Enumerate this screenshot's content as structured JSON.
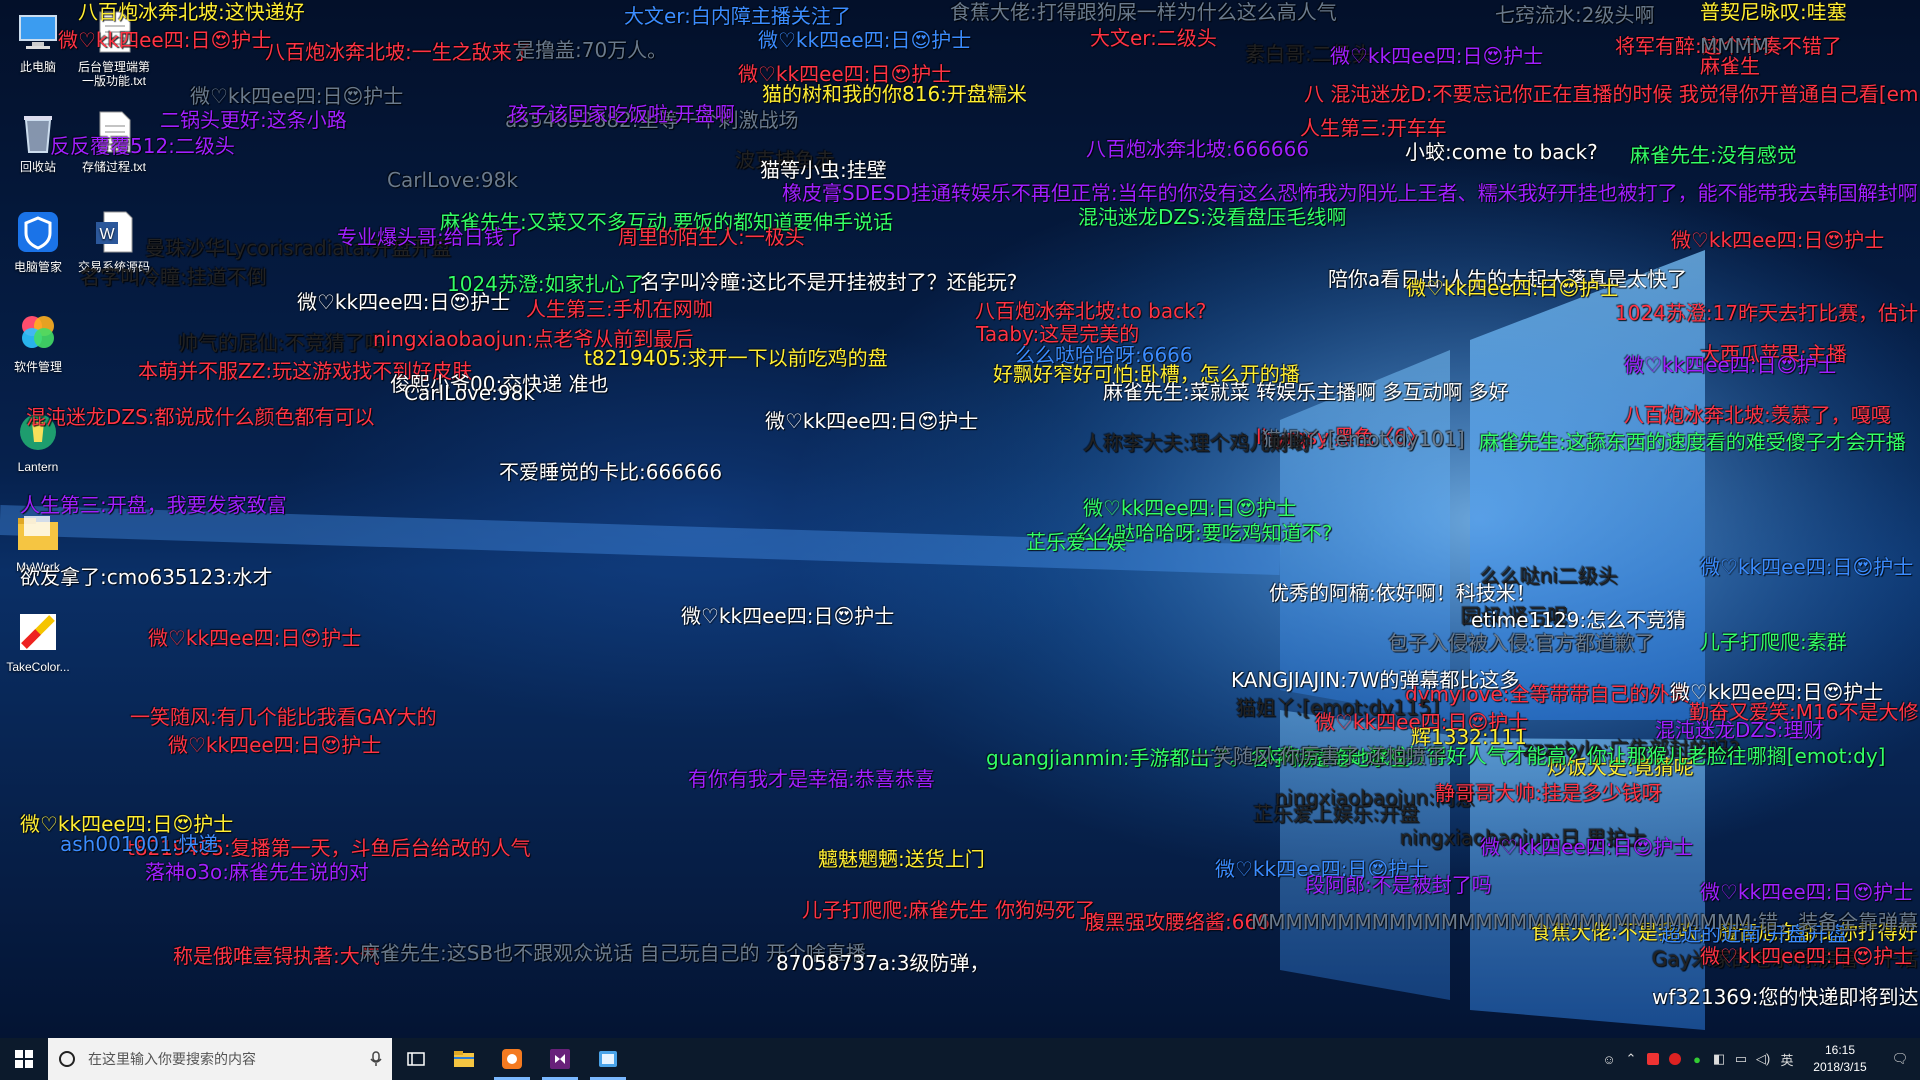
{
  "desktop_icons": [
    {
      "label": "此电脑",
      "icon": "computer-icon"
    },
    {
      "label": "后台管理端第一版功能.txt",
      "icon": "text-file-icon"
    },
    {
      "label": "回收站",
      "icon": "recycle-bin-icon"
    },
    {
      "label": "存储过程.txt",
      "icon": "text-file-icon"
    },
    {
      "label": "电脑管家",
      "icon": "shield-icon"
    },
    {
      "label": "交易系统源码",
      "icon": "word-doc-icon"
    },
    {
      "label": "软件管理",
      "icon": "software-manager-icon"
    },
    {
      "label": "Lantern",
      "icon": "lantern-icon"
    },
    {
      "label": "MyWork",
      "icon": "folder-icon"
    },
    {
      "label": "TakeColor...",
      "icon": "takecolor-icon"
    }
  ],
  "danmaku": [
    {
      "text": "八百炮冰奔北坡:这快递好",
      "color": "#ffee33"
    },
    {
      "text": "大文er:白内障主播关注了",
      "color": "#3b8cff"
    },
    {
      "text": "食蕉大佬:打得跟狗屎一样为什么这么高人气",
      "color": "#6a7a8c"
    },
    {
      "text": "七窍流水:2级头啊",
      "color": "#6a7a8c"
    },
    {
      "text": "普契尼咏叹:哇塞",
      "color": "#ffee33"
    },
    {
      "text": "微♡kk四ee四:日😍护士",
      "color": "#ff3344"
    },
    {
      "text": "微♡kk四ee四:日😍护士",
      "color": "#3b8cff"
    },
    {
      "text": "大文er:二级头",
      "color": "#ff3344"
    },
    {
      "text": "八百炮冰奔北坡:一生之敌来了",
      "color": "#ff3344"
    },
    {
      "text": "是撸盖:70万人。",
      "color": "#6a7a8c"
    },
    {
      "text": "素白哥:二级头",
      "color": "#222222"
    },
    {
      "text": "微♡kk四ee四:日😍护士",
      "color": "#a020ff"
    },
    {
      "text": "将军有醉:这个节奏不错了",
      "color": "#ff3344"
    },
    {
      "text": "MMMM",
      "color": "#6a7a8c"
    },
    {
      "text": "麻雀生",
      "color": "#ff3344"
    },
    {
      "text": "微♡kk四ee四:日😍护士",
      "color": "#ff3344"
    },
    {
      "text": "猫的树和我的你816:开盘糯米",
      "color": "#ffee33"
    },
    {
      "text": "八 混沌迷龙D:不要忘记你正在直播的时候 我觉得你开普通自己看[em",
      "color": "#ff3344"
    },
    {
      "text": "微♡kk四ee四:日😍护士",
      "color": "#6a7a8c"
    },
    {
      "text": "二锅头更好:这条小路",
      "color": "#a020ff"
    },
    {
      "text": "a554032882:坐等一个刺激战场",
      "color": "#6a7a8c"
    },
    {
      "text": "孩子该回家吃饭啦:开盘啊",
      "color": "#a020ff"
    },
    {
      "text": "人生第三:开车车",
      "color": "#ff3344"
    },
    {
      "text": "反反覆覆512:二级头",
      "color": "#a020ff"
    },
    {
      "text": "八百炮冰奔北坡:666666",
      "color": "#a020ff"
    },
    {
      "text": "小蛟:come to back?",
      "color": "#ffffff"
    },
    {
      "text": "麻雀先生:没有感觉",
      "color": "#33ff66"
    },
    {
      "text": "波克捕鱼赤",
      "color": "#222222"
    },
    {
      "text": "猫等小虫:挂壁",
      "color": "#ffffff"
    },
    {
      "text": "CarlLove:98k",
      "color": "#6a7a8c"
    },
    {
      "text": "橡皮膏SDESD挂通转娱乐不再但正常:当年的你没有这么恐怖我为阳光上王者、糯米我好开挂也被打了，能不能带我去韩国解封啊",
      "color": "#a020ff"
    },
    {
      "text": "麻雀先生:又菜又不多互动 要饭的都知道要伸手说话",
      "color": "#33ff66"
    },
    {
      "text": "混沌迷龙DZS:没看盘压毛线啊",
      "color": "#33ff66"
    },
    {
      "text": "曼珠沙华Lycorisradiata:开盘开盘",
      "color": "#222222"
    },
    {
      "text": "专业爆头哥:给日钱了",
      "color": "#a020ff"
    },
    {
      "text": "周里的陌生人:一极头",
      "color": "#ff3344"
    },
    {
      "text": "微♡kk四ee四:日😍护士",
      "color": "#ff3344"
    },
    {
      "text": "名字叫冷瞳:挂道不倒",
      "color": "#222222"
    },
    {
      "text": "1024苏澄:如家扎心了",
      "color": "#33ff66"
    },
    {
      "text": "名字叫冷瞳:这比不是开挂被封了？还能玩?",
      "color": "#ffffff"
    },
    {
      "text": "微♡kk四ee四:日😍护士",
      "color": "#ffffff"
    },
    {
      "text": "人生第三:手机在网咖",
      "color": "#ff3344"
    },
    {
      "text": "八百炮冰奔北坡:to back?",
      "color": "#ff3344"
    },
    {
      "text": "陪你a看日出:人生的大起大落真是太快了",
      "color": "#ffffff"
    },
    {
      "text": "微♡kk四ee四:日😍护士",
      "color": "#ffee33"
    },
    {
      "text": "1024苏澄:17昨天去打比赛，估计",
      "color": "#ff3344"
    },
    {
      "text": "帅气的屁仙:不竞猜了吗",
      "color": "#222222"
    },
    {
      "text": "ningxiaobaojun:点老爷从前到最后",
      "color": "#ff3344"
    },
    {
      "text": "Taaby:这是完美的",
      "color": "#ff3344"
    },
    {
      "text": "t8219405:求开一下以前吃鸡的盘",
      "color": "#ffee33"
    },
    {
      "text": "么么哒哈哈呀:6666",
      "color": "#3b8cff"
    },
    {
      "text": "大西瓜苹果:主播",
      "color": "#ff3344"
    },
    {
      "text": "本萌并不服ZZ:玩这游戏找不到好皮肤",
      "color": "#ff3344"
    },
    {
      "text": "俊熙小爷00:交快递 准也",
      "color": "#ffffff"
    },
    {
      "text": "好飘好窄好可怕:卧槽，怎么开的播",
      "color": "#ffee33"
    },
    {
      "text": "麻雀先生:菜就菜 转娱乐主播啊 多互动啊 多好",
      "color": "#ffffff"
    },
    {
      "text": "八百炮冰奔北坡:羡慕了，嘎嘎",
      "color": "#ff3344"
    },
    {
      "text": "CarlLove:98k",
      "color": "#ffffff"
    },
    {
      "text": "微♡kk四ee四:日😍护士",
      "color": "#a020ff"
    },
    {
      "text": "混沌迷龙DZS:都说成什么颜色都有可以",
      "color": "#ff3344"
    },
    {
      "text": "微♡kk四ee四:日😍护士",
      "color": "#ffffff"
    },
    {
      "text": "lhyrqsy:黑色〈6〉",
      "color": "#ff3344"
    },
    {
      "text": "猫姐丫:[emot:dy101]",
      "color": "#6a7a8c"
    },
    {
      "text": "不爱睡觉的卡比:666666",
      "color": "#ffffff"
    },
    {
      "text": "人称李大夫:理个鸡儿财哟",
      "color": "#222222"
    },
    {
      "text": "微♡kk四ee四:日😍护士",
      "color": "#33ff66"
    },
    {
      "text": "麻雀先生:这舔东西的速度看的难受傻子才会开播",
      "color": "#33ff66"
    },
    {
      "text": "人生第三:开盘，我要发家致富",
      "color": "#a020ff"
    },
    {
      "text": "么么哒哈哈呀:要吃鸡知道不?",
      "color": "#33ff66"
    },
    {
      "text": "芷乐爱上娱",
      "color": "#33ff66"
    },
    {
      "text": "么么哒ni二级头",
      "color": "#222222"
    },
    {
      "text": "微♡kk四ee四:日😍护士",
      "color": "#3b8cff"
    },
    {
      "text": "优秀的阿楠:依好啊！科技米！",
      "color": "#ffffff"
    },
    {
      "text": "欲友拿了:cmo635123:水才",
      "color": "#ffffff"
    },
    {
      "text": "包子入侵被入侵:官方都道歉了",
      "color": "#6a7a8c"
    },
    {
      "text": "园叔:肾亏呢",
      "color": "#222222"
    },
    {
      "text": "微♡kk四ee四:日😍护士",
      "color": "#ffffff"
    },
    {
      "text": "微♡kk四ee四:日😍护士",
      "color": "#ff3344"
    },
    {
      "text": "dymylove:全等带带自己的外卖",
      "color": "#ff3344"
    },
    {
      "text": "etime1129:怎么不竞猜",
      "color": "#ffffff"
    },
    {
      "text": "儿子打爬爬:素群",
      "color": "#33ff66"
    },
    {
      "text": "KANGJIAJIN:7W的弹幕都比这多",
      "color": "#ffffff"
    },
    {
      "text": "微♡kk四ee四:日😍护士",
      "color": "#ffffff"
    },
    {
      "text": "勤奋又爱笑:M16不是大修",
      "color": "#ff3344"
    },
    {
      "text": "猫姐丫:[emot:dy115]",
      "color": "#222222"
    },
    {
      "text": "微♡kk四ee四:日😍护士",
      "color": "#ff3344"
    },
    {
      "text": "辉1332:111",
      "color": "#ffee33"
    },
    {
      "text": "zzzstyle:广告部封的吗?",
      "color": "#222222"
    },
    {
      "text": "炒饭大史:竟猜呢",
      "color": "#ffee33"
    },
    {
      "text": "一笑随风:有几个能比我看GAY大的",
      "color": "#ff3344"
    },
    {
      "text": "guangjianmin:手游都出了。名字就是绝地求生",
      "color": "#33ff66"
    },
    {
      "text": "混沌迷龙DZS:理财",
      "color": "#a020ff"
    },
    {
      "text": "微♡kk四ee四:日😍护士",
      "color": "#ff3344"
    },
    {
      "text": "人称李大夫:游戏打得好人气才能高？你让那猴儿老脸往哪搁[emot:dy]",
      "color": "#33ff66"
    },
    {
      "text": "ningxiaobaojun:同意",
      "color": "#222222"
    },
    {
      "text": "芷乐爱上娱乐:开盘",
      "color": "#222222"
    },
    {
      "text": "有你有我才是幸福:恭喜恭喜",
      "color": "#a020ff"
    },
    {
      "text": "一笑随风:你厉害了 还怕喷子",
      "color": "#6a7a8c"
    },
    {
      "text": "静哥哥大帅:挂是多少钱呀",
      "color": "#ff3344"
    },
    {
      "text": "微♡kk四ee四:日😍护士",
      "color": "#ffee33"
    },
    {
      "text": "t8219405:复播第一天，斗鱼后台给改的人气",
      "color": "#ff3344"
    },
    {
      "text": "ningxiaobaojun:日 男护士",
      "color": "#222222"
    },
    {
      "text": "魑魅魍魉:送货上门",
      "color": "#ffee33"
    },
    {
      "text": "微♡kk四ee四:日😍护士",
      "color": "#3b8cff"
    },
    {
      "text": "微♡kk四ee四:日😍护士",
      "color": "#a020ff"
    },
    {
      "text": "食蕉大佬:不是我吹，魔音旭东都比你打得好",
      "color": "#ffee33"
    },
    {
      "text": "段阿郎:不是被封了吗",
      "color": "#a020ff"
    },
    {
      "text": "ash001001:快递",
      "color": "#3b8cff"
    },
    {
      "text": "儿子打爬爬:麻雀先生 你狗妈死了",
      "color": "#ff3344"
    },
    {
      "text": "微♡kk四ee四:日😍护士",
      "color": "#a020ff"
    },
    {
      "text": "Gay米家的老水啊:房管：干活",
      "color": "#222222"
    },
    {
      "text": "微♡kk四ee四:日😍护士",
      "color": "#ff3344"
    },
    {
      "text": "wf321369:您的快递即将到达",
      "color": "#ffffff"
    },
    {
      "text": "超近的近南:开盘开盘",
      "color": "#3b8cff"
    },
    {
      "text": "落神o3o:麻雀先生说的对",
      "color": "#a020ff"
    },
    {
      "text": "腹黑强攻腰络酱:666",
      "color": "#ff3344"
    },
    {
      "text": "MMMMMMMMMMMMMMMMMMMMMMMMMMMMM:错，装备全靠弹幕",
      "color": "#6a7a8c"
    },
    {
      "text": "称是俄唯壹锝执著:大气",
      "color": "#ff3344"
    },
    {
      "text": "麻雀先生:这SB也不跟观众说话 自己玩自己的 开个啥直播",
      "color": "#6a7a8c"
    },
    {
      "text": "87058737a:3级防弹，",
      "color": "#ffffff"
    }
  ],
  "taskbar": {
    "search_placeholder": "在这里输入你要搜索的内容",
    "pinned": [
      {
        "name": "file-explorer-icon"
      },
      {
        "name": "app-orange-icon"
      },
      {
        "name": "visual-studio-icon"
      },
      {
        "name": "app-blue-icon"
      }
    ],
    "ime": "英",
    "time": "16:15",
    "date": "2018/3/15"
  }
}
